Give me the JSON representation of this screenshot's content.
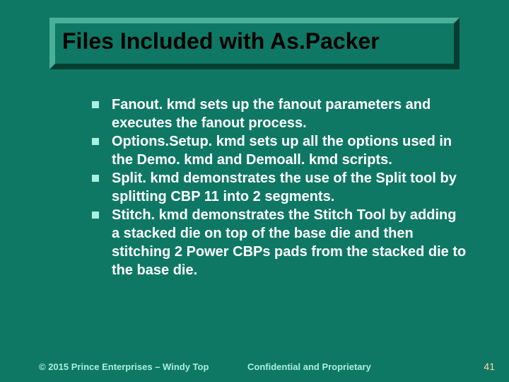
{
  "title": "Files Included with As.Packer",
  "bullets": [
    "Fanout. kmd sets up the fanout parameters and executes the fanout process.",
    "Options.Setup. kmd sets up all the options used in the Demo. kmd and Demoall. kmd scripts.",
    "Split. kmd demonstrates the use of the Split tool by splitting CBP 11 into 2 segments.",
    "Stitch. kmd demonstrates the Stitch Tool by adding a stacked die on top of the base die and then stitching 2 Power CBPs pads from the stacked die to the base die."
  ],
  "footer": {
    "copyright": "© 2015 Prince Enterprises – Windy Top",
    "confidential": "Confidential and Proprietary",
    "page": "41"
  }
}
